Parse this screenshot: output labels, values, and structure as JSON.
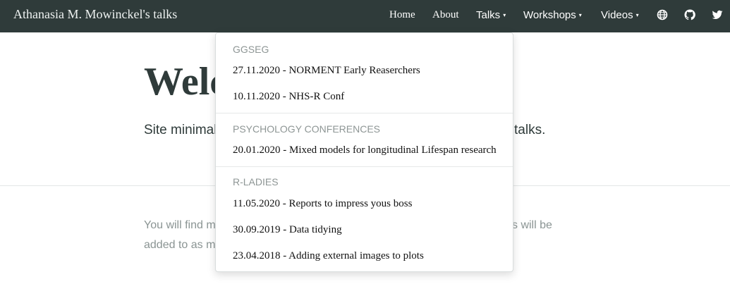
{
  "navbar": {
    "brand": "Athanasia M. Mowinckel's talks",
    "links": {
      "home": "Home",
      "about": "About",
      "talks": "Talks",
      "workshops": "Workshops",
      "videos": "Videos"
    },
    "caret": "▾",
    "icons": [
      "globe-icon",
      "github-icon",
      "twitter-icon"
    ]
  },
  "page": {
    "title_visible": "Welc",
    "intro_left": "Site minimal",
    "intro_right": "talks.",
    "body_line1_left": "You will find m",
    "body_line1_right": "s will be",
    "body_line2_left": "added to as m"
  },
  "dropdown": {
    "groups": [
      {
        "header": "GGSEG",
        "items": [
          "27.11.2020 - NORMENT Early Reaserchers",
          "10.11.2020 - NHS-R Conf"
        ]
      },
      {
        "header": "PSYCHOLOGY CONFERENCES",
        "items": [
          "20.01.2020 - Mixed models for longitudinal Lifespan research"
        ]
      },
      {
        "header": "R-LADIES",
        "items": [
          "11.05.2020 - Reports to impress yous boss",
          "30.09.2019 - Data tidying",
          "23.04.2018 - Adding external images to plots"
        ]
      }
    ]
  },
  "colors": {
    "navbar_bg": "#2f3b3a",
    "title": "#2f3b3a",
    "muted_text": "#8a9493"
  }
}
